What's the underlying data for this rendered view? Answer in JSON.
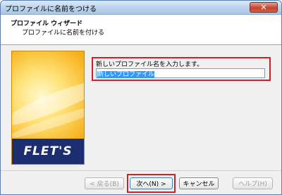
{
  "window": {
    "title": "プロファイルに名前をつける",
    "close_label": "✕"
  },
  "header": {
    "title": "プロファイル ウィザード",
    "subtitle": "プロファイルに名前を付ける"
  },
  "banner": {
    "logo_text": "FLET'S"
  },
  "form": {
    "prompt": "新しいプロファイル名を入力します。",
    "name_value": "新しいプロファイル"
  },
  "buttons": {
    "back": "< 戻る(B)",
    "next": "次へ(N) >",
    "cancel": "キャンセル",
    "help": "ヘルプ(H)"
  }
}
